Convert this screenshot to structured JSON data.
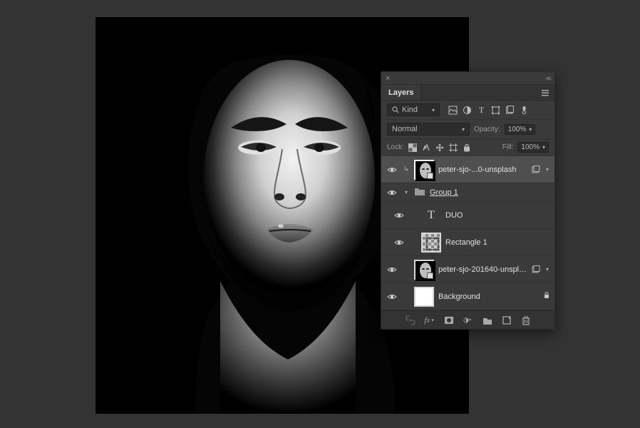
{
  "panel": {
    "tab_label": "Layers",
    "filter": {
      "label": "Kind"
    },
    "blend": {
      "mode": "Normal",
      "opacity_label": "Opacity:",
      "opacity_value": "100%"
    },
    "lock": {
      "label": "Lock:",
      "fill_label": "Fill:",
      "fill_value": "100%"
    },
    "layers": [
      {
        "name": "peter-sjo-...0-unsplash"
      },
      {
        "name": "Group 1"
      },
      {
        "name": "DUO"
      },
      {
        "name": "Rectangle 1"
      },
      {
        "name": "peter-sjo-201640-unsplash"
      },
      {
        "name": "Background"
      }
    ]
  }
}
